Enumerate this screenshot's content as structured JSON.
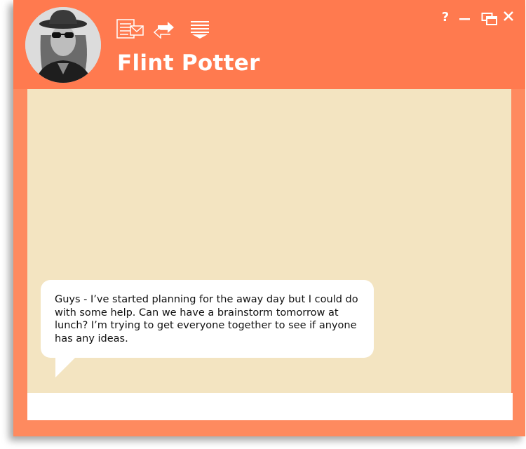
{
  "contact": {
    "name": "Flint Potter",
    "avatar": "avatar-photo"
  },
  "toolbar": {
    "icons": [
      "email-transcript-icon",
      "transfer-icon",
      "menu-dropdown-icon"
    ]
  },
  "window_controls": {
    "help_label": "?",
    "icons": [
      "help-icon",
      "minimize-icon",
      "restore-icon",
      "close-icon"
    ]
  },
  "messages": [
    {
      "text": "Guys - I’ve started planning for the away day but I could do with some help. Can we have a brainstorm tomorrow at lunch? I’m trying to get everyone together to see if anyone has any ideas."
    }
  ],
  "composer": {
    "value": "",
    "placeholder": ""
  },
  "colors": {
    "titlebar": "#ff7a4f",
    "frame": "#fe8a5f",
    "chat_background": "#f3e4c1",
    "bubble": "#ffffff",
    "text": "#ffffff"
  }
}
